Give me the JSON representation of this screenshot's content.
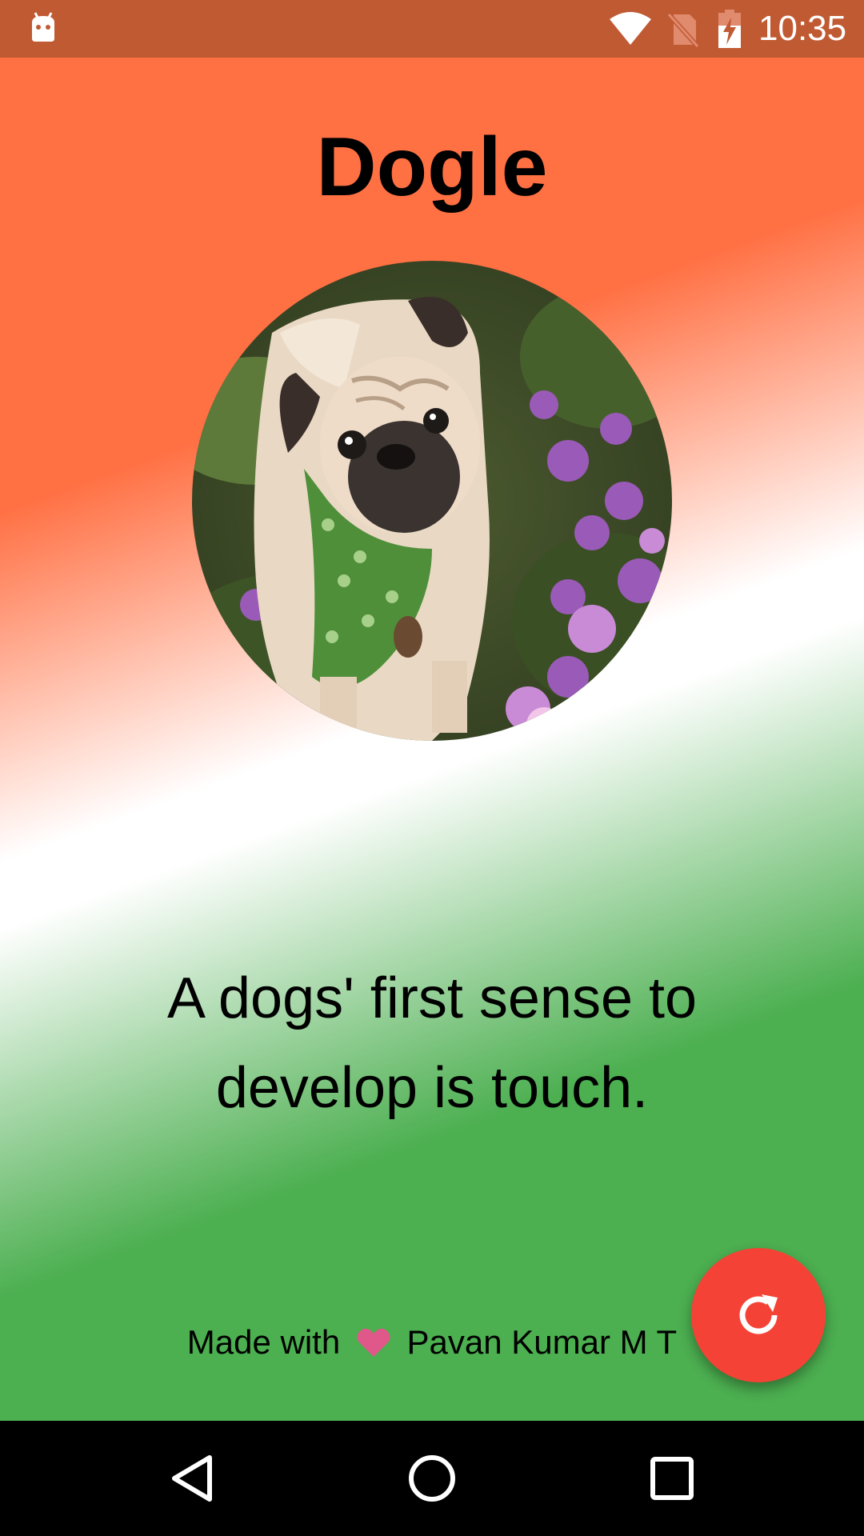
{
  "status_bar": {
    "time": "10:35",
    "icons": [
      "android-notification-icon",
      "wifi-icon",
      "no-sim-icon",
      "battery-charging-icon"
    ]
  },
  "app": {
    "title": "Dogle",
    "fact": "A dogs' first sense to develop is touch.",
    "credit_prefix": "Made with",
    "credit_icon": "heart-icon",
    "credit_author": "Pavan Kumar M T",
    "refresh_icon": "refresh-icon"
  },
  "colors": {
    "status_bar": "#C05A33",
    "saffron": "#FF7043",
    "white": "#FFFFFF",
    "green": "#4CAF50",
    "fab": "#F44336",
    "heart": "#E0588A"
  },
  "nav_bar": {
    "icons": [
      "back-icon",
      "home-icon",
      "recents-icon"
    ]
  }
}
